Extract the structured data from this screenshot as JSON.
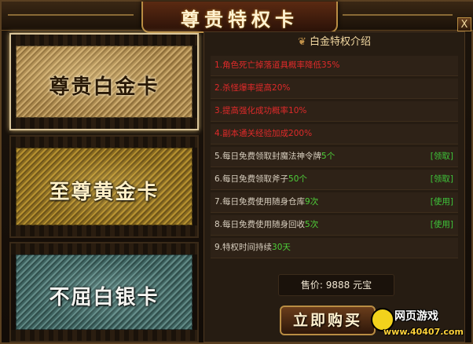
{
  "window": {
    "title": "尊贵特权卡",
    "close_label": "X"
  },
  "cards": [
    {
      "id": "platinum",
      "label": "尊贵白金卡",
      "selected": true
    },
    {
      "id": "gold",
      "label": "至尊黄金卡",
      "selected": false
    },
    {
      "id": "silver",
      "label": "不屈白银卡",
      "selected": false
    }
  ],
  "panel": {
    "header": "白金特权介绍",
    "rows": [
      {
        "num": "1.",
        "text": "角色死亡掉落道具概率降低35%"
      },
      {
        "num": "2.",
        "text": "杀怪爆率提高20%"
      },
      {
        "num": "3.",
        "text": "提高强化成功概率10%"
      },
      {
        "num": "4.",
        "text": "副本通关经验加成200%"
      },
      {
        "num": "5.",
        "pre": "每日免费领取",
        "item": "封魔法神令牌",
        "count": "5个",
        "action": "[领取]"
      },
      {
        "num": "6.",
        "pre": "每日免费领取",
        "item": "斧子",
        "count": "50个",
        "action": "[领取]"
      },
      {
        "num": "7.",
        "pre": "每日免费使用",
        "item": "随身仓库",
        "count": "9次",
        "action": "[使用]"
      },
      {
        "num": "8.",
        "pre": "每日免费使用",
        "item": "随身回收",
        "count": "5次",
        "action": "[使用]"
      },
      {
        "num": "9.",
        "pre": "特权时间持续",
        "count": "30天"
      }
    ],
    "price_label": "售价:",
    "price_value": "9888",
    "price_unit": "元宝",
    "buy_label": "立即购买"
  },
  "watermark": {
    "title": "网页游戏",
    "url": "www.40407.com"
  },
  "colors": {
    "red_text": "#e02a2a",
    "green_text": "#4fd13a",
    "gold_border": "#b98d43"
  }
}
